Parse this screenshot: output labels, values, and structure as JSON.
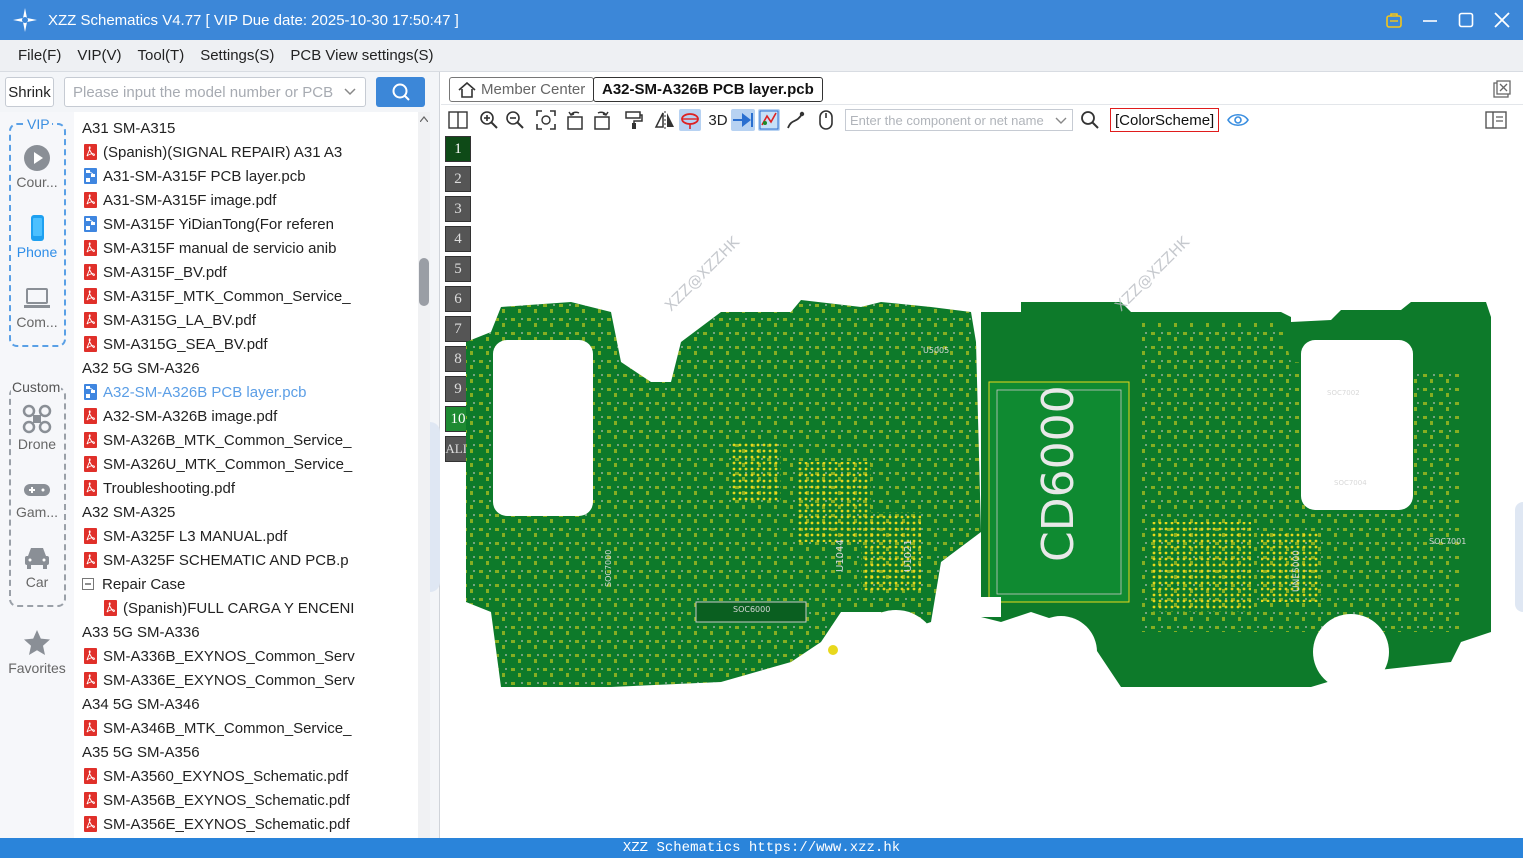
{
  "window": {
    "title": "XZZ Schematics V4.77 [ VIP Due date: 2025-10-30 17:50:47 ]",
    "accent": "#3c87d8"
  },
  "menu": [
    "File(F)",
    "VIP(V)",
    "Tool(T)",
    "Settings(S)",
    "PCB View settings(S)"
  ],
  "search": {
    "shrink_label": "Shrink",
    "placeholder": "Please input the model number or PCB"
  },
  "sidenav": {
    "vip_label": "VIP",
    "custom_label": "Custom",
    "items": [
      {
        "label": "Cour...",
        "icon": "play-icon"
      },
      {
        "label": "Phone",
        "icon": "phone-icon"
      },
      {
        "label": "Com...",
        "icon": "laptop-icon"
      },
      {
        "label": "Drone",
        "icon": "drone-icon"
      },
      {
        "label": "Gam...",
        "icon": "gamepad-icon"
      },
      {
        "label": "Car",
        "icon": "car-icon"
      },
      {
        "label": "Favorites",
        "icon": "star-icon"
      }
    ]
  },
  "tree": [
    {
      "level": 0,
      "type": "folder",
      "label": "A31 SM-A315"
    },
    {
      "level": 1,
      "type": "pdf",
      "label": "(Spanish)(SIGNAL REPAIR) A31 A3"
    },
    {
      "level": 1,
      "type": "pcb",
      "label": "A31-SM-A315F PCB layer.pcb"
    },
    {
      "level": 1,
      "type": "pdf",
      "label": "A31-SM-A315F image.pdf"
    },
    {
      "level": 1,
      "type": "pcb",
      "label": "SM-A315F YiDianTong(For referen"
    },
    {
      "level": 1,
      "type": "pdf",
      "label": "SM-A315F manual de servicio anib"
    },
    {
      "level": 1,
      "type": "pdf",
      "label": "SM-A315F_BV.pdf"
    },
    {
      "level": 1,
      "type": "pdf",
      "label": "SM-A315F_MTK_Common_Service_"
    },
    {
      "level": 1,
      "type": "pdf",
      "label": "SM-A315G_LA_BV.pdf"
    },
    {
      "level": 1,
      "type": "pdf",
      "label": "SM-A315G_SEA_BV.pdf"
    },
    {
      "level": 0,
      "type": "folder",
      "label": "A32 5G SM-A326"
    },
    {
      "level": 1,
      "type": "pcb",
      "label": "A32-SM-A326B PCB layer.pcb",
      "selected": true
    },
    {
      "level": 1,
      "type": "pdf",
      "label": "A32-SM-A326B image.pdf"
    },
    {
      "level": 1,
      "type": "pdf",
      "label": "SM-A326B_MTK_Common_Service_"
    },
    {
      "level": 1,
      "type": "pdf",
      "label": "SM-A326U_MTK_Common_Service_"
    },
    {
      "level": 1,
      "type": "pdf",
      "label": "Troubleshooting.pdf"
    },
    {
      "level": 0,
      "type": "folder",
      "label": "A32 SM-A325"
    },
    {
      "level": 1,
      "type": "pdf",
      "label": "SM-A325F L3 MANUAL.pdf"
    },
    {
      "level": 1,
      "type": "pdf",
      "label": "SM-A325F SCHEMATIC AND PCB.p"
    },
    {
      "level": 1,
      "type": "folder",
      "label": "Repair Case"
    },
    {
      "level": 2,
      "type": "pdf",
      "label": "(Spanish)FULL CARGA Y ENCENI"
    },
    {
      "level": 0,
      "type": "folder",
      "label": "A33 5G SM-A336"
    },
    {
      "level": 1,
      "type": "pdf",
      "label": "SM-A336B_EXYNOS_Common_Serv"
    },
    {
      "level": 1,
      "type": "pdf",
      "label": "SM-A336E_EXYNOS_Common_Serv"
    },
    {
      "level": 0,
      "type": "folder",
      "label": "A34 5G SM-A346"
    },
    {
      "level": 1,
      "type": "pdf",
      "label": "SM-A346B_MTK_Common_Service_"
    },
    {
      "level": 0,
      "type": "folder",
      "label": "A35 5G SM-A356"
    },
    {
      "level": 1,
      "type": "pdf",
      "label": "SM-A3560_EXYNOS_Schematic.pdf"
    },
    {
      "level": 1,
      "type": "pdf",
      "label": "SM-A356B_EXYNOS_Schematic.pdf"
    },
    {
      "level": 1,
      "type": "pdf",
      "label": "SM-A356E_EXYNOS_Schematic.pdf"
    }
  ],
  "tabs": {
    "member": "Member Center",
    "active": "A32-SM-A326B PCB layer.pcb"
  },
  "toolbar": {
    "three_d": "3D",
    "component_placeholder": "Enter the component or net name",
    "colorscheme": "[ColorScheme]"
  },
  "layers": [
    "1",
    "2",
    "3",
    "4",
    "5",
    "6",
    "7",
    "8",
    "9",
    "10",
    "ALL"
  ],
  "pcb": {
    "board_color": "#0d7a2a",
    "pad_color": "#e8d81c",
    "watermark": "XZZ@XZZHK",
    "shield_label": "CD6000",
    "chip_labels": [
      "SOC7000",
      "SOC6000",
      "U1021",
      "U1044",
      "SOC7004",
      "SOC7002",
      "SOC7001",
      "UNE5000",
      "U5005"
    ]
  },
  "status": "XZZ Schematics https://www.xzz.hk"
}
